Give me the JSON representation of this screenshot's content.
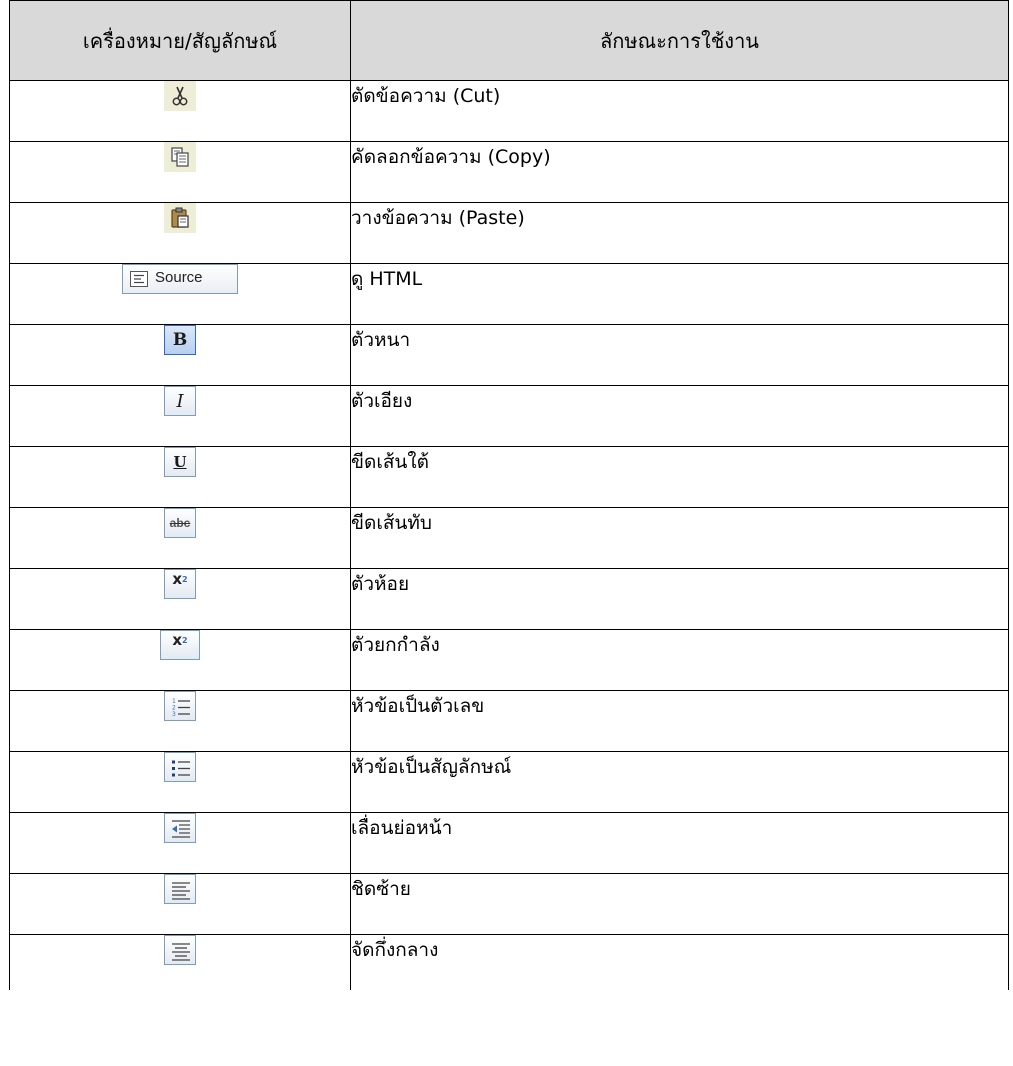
{
  "table": {
    "header_symbol": "เครื่องหมาย/สัญลักษณ์",
    "header_usage": "ลักษณะการใช้งาน",
    "rows": [
      {
        "icon": "scissors-icon",
        "desc": "ตัดข้อความ (Cut)"
      },
      {
        "icon": "copy-icon",
        "desc": "คัดลอกข้อความ (Copy)"
      },
      {
        "icon": "paste-icon",
        "desc": "วางข้อความ (Paste)"
      },
      {
        "icon": "source-icon",
        "label": "Source",
        "desc": "ดู HTML"
      },
      {
        "icon": "bold-icon",
        "label": "B",
        "desc": "ตัวหนา"
      },
      {
        "icon": "italic-icon",
        "label": "I",
        "desc": "ตัวเอียง"
      },
      {
        "icon": "underline-icon",
        "label": "U",
        "desc": "ขีดเส้นใต้"
      },
      {
        "icon": "strikethrough-icon",
        "label": "abc",
        "desc": "ขีดเส้นทับ"
      },
      {
        "icon": "subscript-icon",
        "label": "x",
        "desc": "ตัวห้อย"
      },
      {
        "icon": "superscript-icon",
        "label": "x",
        "desc": "ตัวยกกำลัง"
      },
      {
        "icon": "numbered-list-icon",
        "desc": "หัวข้อเป็นตัวเลข"
      },
      {
        "icon": "bulleted-list-icon",
        "desc": "หัวข้อเป็นสัญลักษณ์"
      },
      {
        "icon": "outdent-icon",
        "desc": "เลื่อนย่อหน้า"
      },
      {
        "icon": "align-left-icon",
        "desc": "ชิดซ้าย"
      },
      {
        "icon": "align-center-icon",
        "desc": "จัดกึ่งกลาง"
      }
    ]
  },
  "colors": {
    "header_bg": "#d9d9d9",
    "border": "#000000",
    "icon_blue": "#3b6bb5"
  }
}
